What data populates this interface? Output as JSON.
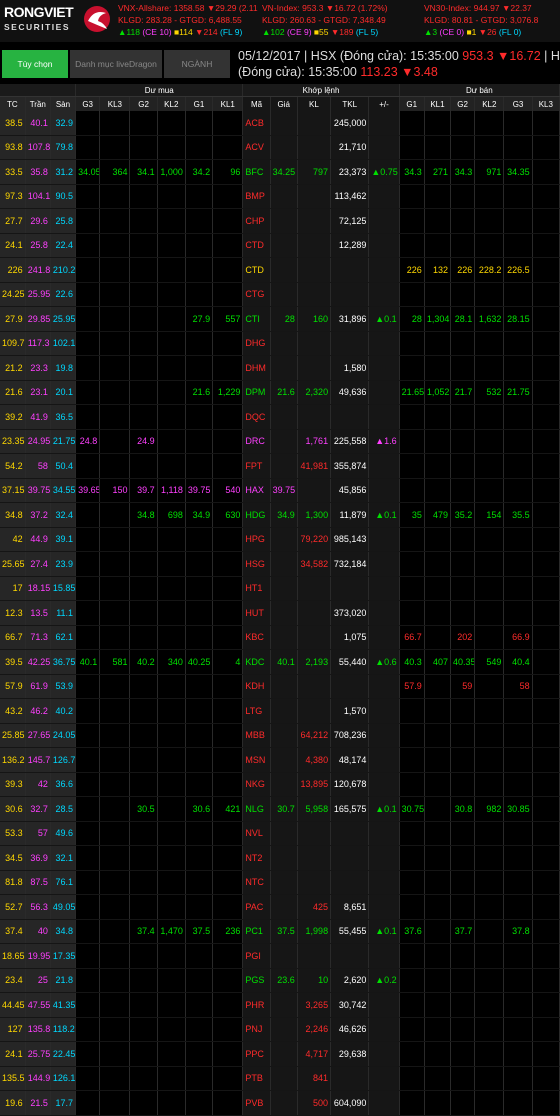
{
  "brand": {
    "name_top": "RONGVIET",
    "name_bottom": "SECURITIES"
  },
  "indices": [
    {
      "line1": "VNX-Allshare: 1358.58 ▼29.29 (2.11%)",
      "line2": "KLGD: 283.28 - GTGD: 6,488.55",
      "line3": [
        [
          "▲118",
          "grn"
        ],
        [
          "(CE 10)",
          "pur"
        ],
        [
          "■114",
          "yel"
        ],
        [
          "▼214",
          "red"
        ],
        [
          "(FL 9)",
          "cyn"
        ]
      ]
    },
    {
      "line1": "VN-Index: 953.3 ▼16.72 (1.72%)",
      "line2": "KLGD: 260.63 - GTGD: 7,348.49",
      "line3": [
        [
          "▲102",
          "grn"
        ],
        [
          "(CE 9)",
          "pur"
        ],
        [
          "■55",
          "yel"
        ],
        [
          "▼189",
          "red"
        ],
        [
          "(FL 5)",
          "cyn"
        ]
      ]
    },
    {
      "line1": "VN30-Index: 944.97 ▼22.37",
      "line2": "KLGD: 80.81 - GTGD: 3,076.8",
      "line3": [
        [
          "▲3",
          "grn"
        ],
        [
          "(CE 0)",
          "pur"
        ],
        [
          "■1",
          "yel"
        ],
        [
          "▼26",
          "red"
        ],
        [
          "(FL 0)",
          "cyn"
        ]
      ]
    }
  ],
  "tabs": [
    "Tùy chọn",
    "Danh mục liveDragon",
    "NGÀNH"
  ],
  "header_info": {
    "line1_prefix": "05/12/2017 | HSX (Đóng cửa): 15:35:00",
    "line1_value": "953.3 ▼16.72",
    "line1_suffix": "| HNX",
    "line2_prefix": "(Đóng cửa): 15:35:00",
    "line2_value": "113.23 ▼3.48"
  },
  "groups": {
    "ref": "",
    "buy": "Dư mua",
    "match": "Khớp lệnh",
    "sell": "Dư bán"
  },
  "columns": [
    "TC",
    "Trần",
    "Sàn",
    "G3",
    "KL3",
    "G2",
    "KL2",
    "G1",
    "KL1",
    "Mã",
    "Giá",
    "KL",
    "TKL",
    "+/-",
    "G1",
    "KL1",
    "G2",
    "KL2",
    "G3",
    "KL3"
  ],
  "rows": [
    [
      "38.5",
      "40.1",
      "32.9",
      "",
      "",
      "",
      "",
      "",
      "",
      "ACB",
      "",
      "",
      "245,000",
      "",
      "",
      "",
      "",
      "",
      "",
      ""
    ],
    [
      "93.8",
      "107.8",
      "79.8",
      "",
      "",
      "",
      "",
      "",
      "",
      "ACV",
      "",
      "",
      "21,710",
      "",
      "",
      "",
      "",
      "",
      "",
      ""
    ],
    [
      "33.5",
      "35.8",
      "31.2",
      "34.05",
      "364",
      "34.1",
      "1,000",
      "34.2",
      "96",
      "BFC",
      "34.25",
      "797",
      "23,373",
      "▲0.75",
      "34.3",
      "271",
      "34.3",
      "971",
      "34.35",
      ""
    ],
    [
      "97.3",
      "104.1",
      "90.5",
      "",
      "",
      "",
      "",
      "",
      "",
      "BMP",
      "",
      "",
      "113,462",
      "",
      "",
      "",
      "",
      "",
      "",
      ""
    ],
    [
      "27.7",
      "29.6",
      "25.8",
      "",
      "",
      "",
      "",
      "",
      "",
      "CHP",
      "",
      "",
      "72,125",
      "",
      "",
      "",
      "",
      "",
      "",
      ""
    ],
    [
      "24.1",
      "25.8",
      "22.4",
      "",
      "",
      "",
      "",
      "",
      "",
      "CTD",
      "",
      "",
      "12,289",
      "",
      "",
      "",
      "",
      "",
      "",
      ""
    ],
    [
      "226",
      "241.8",
      "210.2",
      "",
      "",
      "",
      "",
      "",
      "",
      "CTD",
      "",
      "",
      "",
      "",
      "226",
      "132",
      "226",
      "228.2",
      "226.5",
      ""
    ],
    [
      "24.25",
      "25.95",
      "22.6",
      "",
      "",
      "",
      "",
      "",
      "",
      "CTG",
      "",
      "",
      "",
      "",
      "",
      "",
      "",
      "",
      "",
      ""
    ],
    [
      "27.9",
      "29.85",
      "25.95",
      "",
      "",
      "",
      "",
      "27.9",
      "557",
      "CTI",
      "28",
      "160",
      "31,896",
      "▲0.1",
      "28",
      "1,304",
      "28.1",
      "1,632",
      "28.15",
      ""
    ],
    [
      "109.7",
      "117.3",
      "102.1",
      "",
      "",
      "",
      "",
      "",
      "",
      "DHG",
      "",
      "",
      "",
      "",
      "",
      "",
      "",
      "",
      "",
      ""
    ],
    [
      "21.2",
      "23.3",
      "19.8",
      "",
      "",
      "",
      "",
      "",
      "",
      "DHM",
      "",
      "",
      "1,580",
      "",
      "",
      "",
      "",
      "",
      "",
      ""
    ],
    [
      "21.6",
      "23.1",
      "20.1",
      "",
      "",
      "",
      "",
      "21.6",
      "1,229",
      "DPM",
      "21.6",
      "2,320",
      "49,636",
      "",
      "21.65",
      "1,052",
      "21.7",
      "532",
      "21.75",
      ""
    ],
    [
      "39.2",
      "41.9",
      "36.5",
      "",
      "",
      "",
      "",
      "",
      "",
      "DQC",
      "",
      "",
      "",
      "",
      "",
      "",
      "",
      "",
      "",
      ""
    ],
    [
      "23.35",
      "24.95",
      "21.75",
      "24.8",
      "",
      "24.9",
      "",
      "",
      "",
      "DRC",
      "",
      "1,761",
      "225,558",
      "▲1.6",
      "",
      "",
      "",
      "",
      "",
      ""
    ],
    [
      "54.2",
      "58",
      "50.4",
      "",
      "",
      "",
      "",
      "",
      "",
      "FPT",
      "",
      "41,981",
      "355,874",
      "",
      "",
      "",
      "",
      "",
      "",
      ""
    ],
    [
      "37.15",
      "39.75",
      "34.55",
      "39.65",
      "150",
      "39.7",
      "1,118",
      "39.75",
      "540",
      "HAX",
      "39.75",
      "",
      "45,856",
      "",
      "",
      "",
      "",
      "",
      "",
      ""
    ],
    [
      "34.8",
      "37.2",
      "32.4",
      "",
      "",
      "34.8",
      "698",
      "34.9",
      "630",
      "HDG",
      "34.9",
      "1,300",
      "11,879",
      "▲0.1",
      "35",
      "479",
      "35.2",
      "154",
      "35.5",
      ""
    ],
    [
      "42",
      "44.9",
      "39.1",
      "",
      "",
      "",
      "",
      "",
      "",
      "HPG",
      "",
      "79,220",
      "985,143",
      "",
      "",
      "",
      "",
      "",
      "",
      ""
    ],
    [
      "25.65",
      "27.4",
      "23.9",
      "",
      "",
      "",
      "",
      "",
      "",
      "HSG",
      "",
      "34,582",
      "732,184",
      "",
      "",
      "",
      "",
      "",
      "",
      ""
    ],
    [
      "17",
      "18.15",
      "15.85",
      "",
      "",
      "",
      "",
      "",
      "",
      "HT1",
      "",
      "",
      "",
      "",
      "",
      "",
      "",
      "",
      "",
      ""
    ],
    [
      "12.3",
      "13.5",
      "11.1",
      "",
      "",
      "",
      "",
      "",
      "",
      "HUT",
      "",
      "",
      "373,020",
      "",
      "",
      "",
      "",
      "",
      "",
      ""
    ],
    [
      "66.7",
      "71.3",
      "62.1",
      "",
      "",
      "",
      "",
      "",
      "",
      "KBC",
      "",
      "",
      "1,075",
      "",
      "66.7",
      "",
      "202",
      "",
      "66.9",
      ""
    ],
    [
      "39.5",
      "42.25",
      "36.75",
      "40.1",
      "581",
      "40.2",
      "340",
      "40.25",
      "4",
      "KDC",
      "40.1",
      "2,193",
      "55,440",
      "▲0.6",
      "40.3",
      "407",
      "40.35",
      "549",
      "40.4",
      ""
    ],
    [
      "57.9",
      "61.9",
      "53.9",
      "",
      "",
      "",
      "",
      "",
      "",
      "KDH",
      "",
      "",
      "",
      "",
      "57.9",
      "",
      "59",
      "",
      "58",
      ""
    ],
    [
      "43.2",
      "46.2",
      "40.2",
      "",
      "",
      "",
      "",
      "",
      "",
      "LTG",
      "",
      "",
      "1,570",
      "",
      "",
      "",
      "",
      "",
      "",
      ""
    ],
    [
      "25.85",
      "27.65",
      "24.05",
      "",
      "",
      "",
      "",
      "",
      "",
      "MBB",
      "",
      "64,212",
      "708,236",
      "",
      "",
      "",
      "",
      "",
      "",
      ""
    ],
    [
      "136.2",
      "145.7",
      "126.7",
      "",
      "",
      "",
      "",
      "",
      "",
      "MSN",
      "",
      "4,380",
      "48,174",
      "",
      "",
      "",
      "",
      "",
      "",
      ""
    ],
    [
      "39.3",
      "42",
      "36.6",
      "",
      "",
      "",
      "",
      "",
      "",
      "NKG",
      "",
      "13,895",
      "120,678",
      "",
      "",
      "",
      "",
      "",
      "",
      ""
    ],
    [
      "30.6",
      "32.7",
      "28.5",
      "",
      "",
      "30.5",
      "",
      "30.6",
      "421",
      "NLG",
      "30.7",
      "5,958",
      "165,575",
      "▲0.1",
      "30.75",
      "",
      "30.8",
      "982",
      "30.85",
      ""
    ],
    [
      "53.3",
      "57",
      "49.6",
      "",
      "",
      "",
      "",
      "",
      "",
      "NVL",
      "",
      "",
      "",
      "",
      "",
      "",
      "",
      "",
      "",
      ""
    ],
    [
      "34.5",
      "36.9",
      "32.1",
      "",
      "",
      "",
      "",
      "",
      "",
      "NT2",
      "",
      "",
      "",
      "",
      "",
      "",
      "",
      "",
      "",
      ""
    ],
    [
      "81.8",
      "87.5",
      "76.1",
      "",
      "",
      "",
      "",
      "",
      "",
      "NTC",
      "",
      "",
      "",
      "",
      "",
      "",
      "",
      "",
      "",
      ""
    ],
    [
      "52.7",
      "56.3",
      "49.05",
      "",
      "",
      "",
      "",
      "",
      "",
      "PAC",
      "",
      "425",
      "8,651",
      "",
      "",
      "",
      "",
      "",
      "",
      ""
    ],
    [
      "37.4",
      "40",
      "34.8",
      "",
      "",
      "37.4",
      "1,470",
      "37.5",
      "236",
      "PC1",
      "37.5",
      "1,998",
      "55,455",
      "▲0.1",
      "37.6",
      "",
      "37.7",
      "",
      "37.8",
      ""
    ],
    [
      "18.65",
      "19.95",
      "17.35",
      "",
      "",
      "",
      "",
      "",
      "",
      "PGI",
      "",
      "",
      "",
      "",
      "",
      "",
      "",
      "",
      "",
      ""
    ],
    [
      "23.4",
      "25",
      "21.8",
      "",
      "",
      "",
      "",
      "",
      "",
      "PGS",
      "23.6",
      "10",
      "2,620",
      "▲0.2",
      "",
      "",
      "",
      "",
      "",
      ""
    ],
    [
      "44.45",
      "47.55",
      "41.35",
      "",
      "",
      "",
      "",
      "",
      "",
      "PHR",
      "",
      "3,265",
      "30,742",
      "",
      "",
      "",
      "",
      "",
      "",
      ""
    ],
    [
      "127",
      "135.8",
      "118.2",
      "",
      "",
      "",
      "",
      "",
      "",
      "PNJ",
      "",
      "2,246",
      "46,626",
      "",
      "",
      "",
      "",
      "",
      "",
      ""
    ],
    [
      "24.1",
      "25.75",
      "22.45",
      "",
      "",
      "",
      "",
      "",
      "",
      "PPC",
      "",
      "4,717",
      "29,638",
      "",
      "",
      "",
      "",
      "",
      "",
      ""
    ],
    [
      "135.5",
      "144.9",
      "126.1",
      "",
      "",
      "",
      "",
      "",
      "",
      "PTB",
      "",
      "841",
      "",
      "",
      "",
      "",
      "",
      "",
      "",
      ""
    ],
    [
      "19.6",
      "21.5",
      "17.7",
      "",
      "",
      "",
      "",
      "",
      "",
      "PVB",
      "",
      "500",
      "604,090",
      "",
      "",
      "",
      "",
      "",
      "",
      ""
    ]
  ],
  "row_colors": [
    "red",
    "red",
    "grn",
    "red",
    "red",
    "red",
    "yel",
    "red",
    "grn",
    "red",
    "red",
    "grn",
    "red",
    "pur",
    "red",
    "pur",
    "grn",
    "red",
    "red",
    "red",
    "red",
    "red",
    "grn",
    "red",
    "red",
    "red",
    "red",
    "red",
    "grn",
    "red",
    "red",
    "red",
    "red",
    "grn",
    "red",
    "grn",
    "red",
    "red",
    "red",
    "red",
    "red"
  ]
}
